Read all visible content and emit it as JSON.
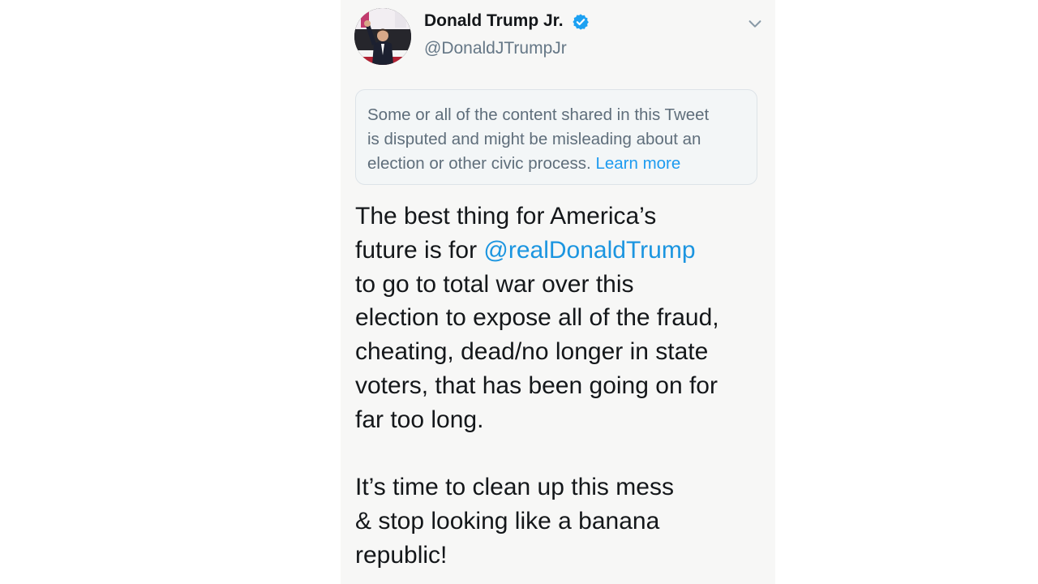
{
  "author": {
    "name": "Donald Trump Jr.",
    "handle": "@DonaldJTrumpJr",
    "verified": true
  },
  "notice": {
    "text": "Some or all of the content shared in this Tweet is disputed and might be misleading about an election or other civic process.",
    "lines": [
      "Some or all of the content shared in this Tweet",
      "is disputed and might be misleading about an",
      "election or other civic process."
    ],
    "link_label": "Learn more"
  },
  "tweet": {
    "paragraph1": {
      "line1": "The best thing for America’s",
      "line2_prefix": "future is for ",
      "mention": "@realDonaldTrump",
      "line3": "to go to total war over this",
      "line4": "election to expose all of the fraud,",
      "line5": "cheating, dead/no longer in state",
      "line6": "voters, that has been going on for",
      "line7": "far too long."
    },
    "paragraph2": {
      "line1": "It’s time to clean up this mess",
      "line2": "& stop looking like a banana",
      "line3": "republic!"
    }
  },
  "icons": {
    "verified": "verified-badge-icon",
    "menu": "chevron-down-icon"
  },
  "colors": {
    "link": "#1d9bf0",
    "verified": "#1da1f2",
    "text": "#14171a",
    "secondary": "#657786"
  }
}
